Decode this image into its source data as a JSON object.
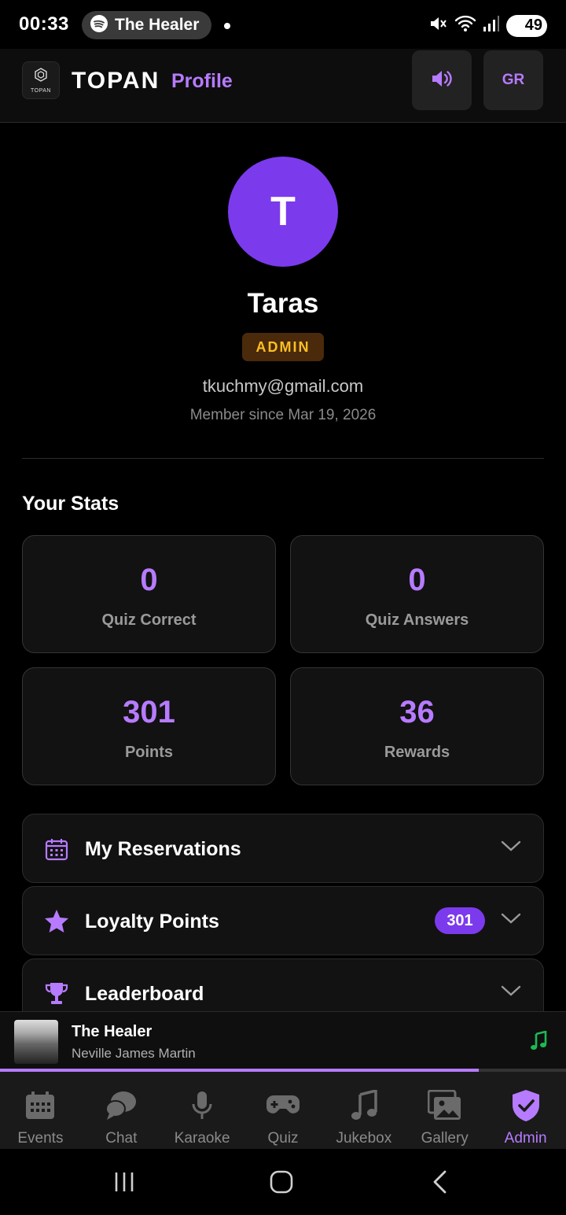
{
  "status_bar": {
    "time": "00:33",
    "media_pill_title": "The Healer",
    "battery": "49"
  },
  "header": {
    "logo_text": "TOPAN",
    "brand": "TOPAN",
    "title": "Profile",
    "lang_button": "GR"
  },
  "profile": {
    "avatar_initial": "T",
    "name": "Taras",
    "role": "ADMIN",
    "email": "tkuchmy@gmail.com",
    "member_since": "Member since Mar 19, 2026"
  },
  "stats": {
    "title": "Your Stats",
    "items": [
      {
        "value": "0",
        "label": "Quiz Correct"
      },
      {
        "value": "0",
        "label": "Quiz Answers"
      },
      {
        "value": "301",
        "label": "Points"
      },
      {
        "value": "36",
        "label": "Rewards"
      }
    ]
  },
  "sections": [
    {
      "label": "My Reservations",
      "icon": "calendar-icon"
    },
    {
      "label": "Loyalty Points",
      "icon": "star-icon",
      "badge": "301"
    },
    {
      "label": "Leaderboard",
      "icon": "trophy-icon"
    }
  ],
  "now_playing": {
    "title": "The Healer",
    "artist": "Neville James Martin",
    "progress": 0.846
  },
  "tabs": [
    {
      "label": "Events",
      "icon": "calendar-grid-icon",
      "active": false
    },
    {
      "label": "Chat",
      "icon": "chat-bubbles-icon",
      "active": false
    },
    {
      "label": "Karaoke",
      "icon": "microphone-icon",
      "active": false
    },
    {
      "label": "Quiz",
      "icon": "gamepad-icon",
      "active": false
    },
    {
      "label": "Jukebox",
      "icon": "music-note-icon",
      "active": false
    },
    {
      "label": "Gallery",
      "icon": "images-icon",
      "active": false
    },
    {
      "label": "Admin",
      "icon": "shield-check-icon",
      "active": true
    }
  ],
  "colors": {
    "accent": "#b77bff",
    "accent_fill": "#7c3aed",
    "admin_badge_bg": "#4a2a0a",
    "admin_badge_text": "#fbbf24",
    "spotify_green": "#1db954"
  }
}
